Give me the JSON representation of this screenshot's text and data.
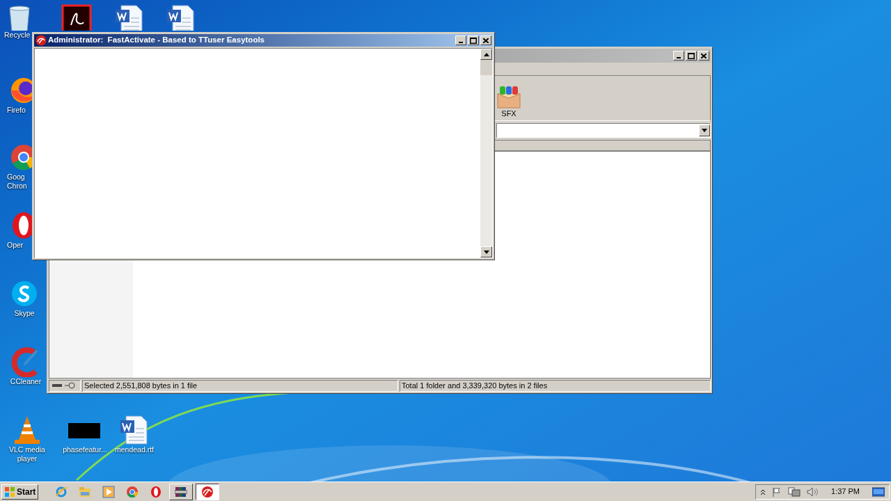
{
  "desktop_icons": [
    {
      "kind": "recycle",
      "label": "Recycle"
    },
    {
      "kind": "pdf"
    },
    {
      "kind": "word"
    },
    {
      "kind": "word"
    },
    {
      "kind": "firefox",
      "label": "Firefo"
    },
    {
      "kind": "chrome",
      "label": "Goog Chron"
    },
    {
      "kind": "opera",
      "label": "Oper"
    },
    {
      "kind": "skype",
      "label": "Skype"
    },
    {
      "kind": "ccleaner",
      "label": "CCleaner"
    },
    {
      "kind": "vlc",
      "label": "VLC media player"
    },
    {
      "kind": "black",
      "label": "phasefeatur..."
    },
    {
      "kind": "word",
      "label": "mendead.rtf"
    }
  ],
  "back_window": {
    "active": false,
    "toolbar": [
      {
        "label": "SFX"
      }
    ],
    "status": [
      "Selected 2,551,808 bytes in 1 file",
      "Total 1 folder and 3,339,320 bytes in 2 files"
    ]
  },
  "front_window": {
    "active": true,
    "title": "Administrator:  FastActivate - Based to TTuser Easytools"
  },
  "taskbar": {
    "start": "Start",
    "quick_launch": [
      {
        "kind": "ie"
      },
      {
        "kind": "folder"
      },
      {
        "kind": "media"
      },
      {
        "kind": "chrome"
      },
      {
        "kind": "opera"
      }
    ],
    "tasks": [
      {
        "kind": "winrar",
        "selected": false
      },
      {
        "kind": "fastactivate",
        "selected": true
      }
    ],
    "clock": "1:37 PM"
  }
}
